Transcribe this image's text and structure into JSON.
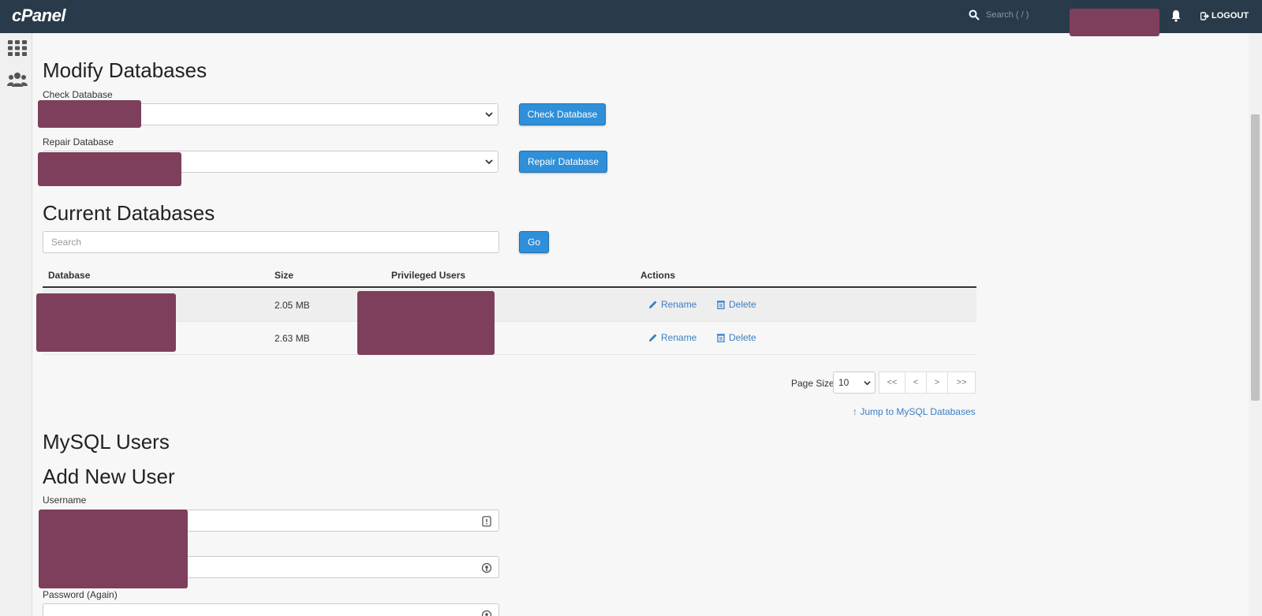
{
  "header": {
    "logo": "cPanel",
    "search_placeholder": "Search ( / )",
    "logout": "LOGOUT"
  },
  "modify": {
    "title": "Modify Databases",
    "check_label": "Check Database",
    "check_button": "Check Database",
    "repair_label": "Repair Database",
    "repair_button": "Repair Database"
  },
  "current": {
    "title": "Current Databases",
    "search_placeholder": "Search",
    "go_button": "Go",
    "columns": [
      "Database",
      "Size",
      "Privileged Users",
      "Actions"
    ],
    "rows": [
      {
        "size": "2.05 MB",
        "rename": "Rename",
        "delete": "Delete"
      },
      {
        "size": "2.63 MB",
        "rename": "Rename",
        "delete": "Delete"
      }
    ],
    "page_size_label": "Page Size",
    "page_size": "10",
    "pager": [
      "<<",
      "<",
      ">",
      ">>"
    ],
    "jump_link": "Jump to MySQL Databases"
  },
  "users": {
    "title": "MySQL Users",
    "add_title": "Add New User",
    "username_label": "Username",
    "password_again_label": "Password (Again)"
  },
  "colors": {
    "topbar": "#293a4a",
    "accent": "#2f8fd8",
    "redaction": "#7e3f5d"
  }
}
